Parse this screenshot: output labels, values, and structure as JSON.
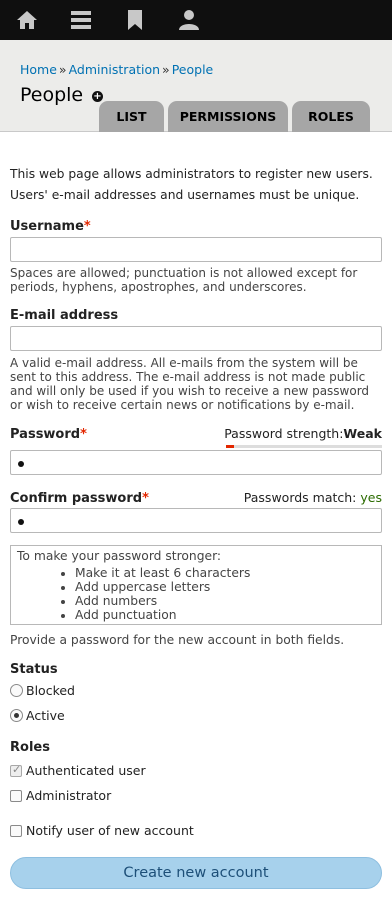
{
  "toolbar": {
    "icons": [
      "home-icon",
      "menu-icon",
      "bookmark-icon",
      "user-icon"
    ]
  },
  "breadcrumb": {
    "items": [
      "Home",
      "Administration",
      "People"
    ],
    "separator": "»"
  },
  "page": {
    "title": "People",
    "shortcut_glyph": "+"
  },
  "tabs": [
    "LIST",
    "PERMISSIONS",
    "ROLES"
  ],
  "intro": "This web page allows administrators to register new users. Users' e-mail addresses and usernames must be unique.",
  "username": {
    "label": "Username",
    "required": "*",
    "value": "",
    "description": "Spaces are allowed; punctuation is not allowed except for periods, hyphens, apostrophes, and underscores."
  },
  "email": {
    "label": "E-mail address",
    "value": "",
    "description": "A valid e-mail address. All e-mails from the system will be sent to this address. The e-mail address is not made public and will only be used if you wish to receive a new password or wish to receive certain news or notifications by e-mail."
  },
  "password": {
    "label": "Password",
    "required": "*",
    "strength_label": "Password strength:",
    "strength_value": "Weak",
    "strength_level": 0.05,
    "strength_color": "#e32700"
  },
  "confirm_password": {
    "label": "Confirm password",
    "required": "*",
    "match_label": "Passwords match:",
    "match_value": "yes"
  },
  "tips": {
    "heading": "To make your password stronger:",
    "items": [
      "Make it at least 6 characters",
      "Add uppercase letters",
      "Add numbers",
      "Add punctuation"
    ]
  },
  "password_help": "Provide a password for the new account in both fields.",
  "status": {
    "label": "Status",
    "options": [
      "Blocked",
      "Active"
    ],
    "selected": "Active"
  },
  "roles": {
    "label": "Roles",
    "options": [
      "Authenticated user",
      "Administrator"
    ],
    "checked": [
      "Authenticated user"
    ]
  },
  "notify": {
    "label": "Notify user of new account",
    "checked": false
  },
  "submit": {
    "label": "Create new account"
  },
  "colors": {
    "link": "#0071b3",
    "required": "#e32700",
    "button_bg": "#a7d1ec",
    "button_text": "#1d4f78",
    "toolbar_bg": "#0f0f0f",
    "toolbar_icon": "#c8c8c8"
  }
}
